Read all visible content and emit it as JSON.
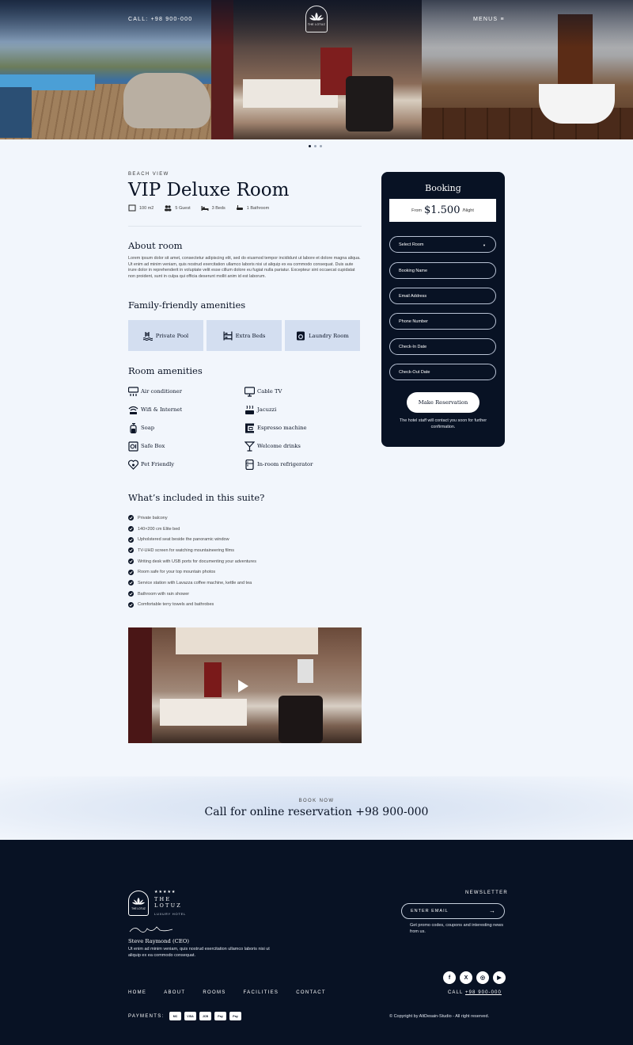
{
  "header": {
    "call_label": "CALL: +98 900-000",
    "menu_label": "MENUS",
    "logo_text": "THE LOTUZ"
  },
  "room": {
    "eyebrow": "BEACH VIEW",
    "title": "VIP Deluxe Room",
    "specs": {
      "size": "100 m2",
      "guests": "5 Guest",
      "beds": "3 Beds",
      "bathrooms": "1 Bathroom"
    }
  },
  "about": {
    "heading": "About room",
    "text": "Lorem ipsum dolor sit amet, consectetur adipiscing elit, sed do eiusmod tempor incididunt ut labore et dolore magna aliqua. Ut enim ad minim veniam, quis nostrud exercitation ullamco laboris nisi ut aliquip ex ea commodo consequat. Duis aute irure dolor in reprehenderit in voluptate velit esse cillum dolore eu fugiat nulla pariatur. Excepteur sint occaecat cupidatat non proident, sunt in culpa qui officia deserunt mollit anim id est laborum."
  },
  "family": {
    "heading": "Family-friendly amenities",
    "items": [
      {
        "label": "Private Pool",
        "icon": "pool-icon"
      },
      {
        "label": "Extra Beds",
        "icon": "bunk-bed-icon"
      },
      {
        "label": "Laundry Room",
        "icon": "washing-machine-icon"
      }
    ]
  },
  "amenities": {
    "heading": "Room amenities",
    "items": [
      {
        "label": "Air conditioner",
        "icon": "air-conditioner-icon"
      },
      {
        "label": "Cable TV",
        "icon": "tv-icon"
      },
      {
        "label": "Wifi & Internet",
        "icon": "wifi-icon"
      },
      {
        "label": "Jacuzzi",
        "icon": "jacuzzi-icon"
      },
      {
        "label": "Soap",
        "icon": "soap-icon"
      },
      {
        "label": "Espresso machine",
        "icon": "espresso-icon"
      },
      {
        "label": "Safe Box",
        "icon": "safe-icon"
      },
      {
        "label": "Welcome drinks",
        "icon": "cocktail-icon"
      },
      {
        "label": "Pet Friendly",
        "icon": "pet-heart-icon"
      },
      {
        "label": "In-room refrigerator",
        "icon": "fridge-icon"
      }
    ]
  },
  "included": {
    "heading": "What’s included in this suite?",
    "items": [
      "Private balcony",
      "140×200 cm Elite bed",
      "Upholstered seat beside the panoramic window",
      "TV-UHD screen for watching mountaineering films",
      "Writing desk with USB ports for documenting your adventures",
      "Room safe for your top mountain photos",
      "Service station with Lavazza coffee machine, kettle and tea",
      "Bathroom with rain shower",
      "Comfortable terry towels and bathrobes"
    ]
  },
  "booking": {
    "title": "Booking",
    "price_from": "From",
    "price_amount": "$1.500",
    "price_unit": "/Night",
    "fields": {
      "room": "Select Room",
      "name": "Booking Name",
      "email": "Email Address",
      "phone": "Phone Number",
      "checkin": "Check-In Date",
      "checkout": "Check-Out Date"
    },
    "button": "Make Reservation",
    "note": "The hotel staff will contact you soon for further confirmation."
  },
  "cta": {
    "eyebrow": "BOOK NOW",
    "title": "Call for online reservation +98 900-000"
  },
  "footer": {
    "stars": "★★★★★",
    "brand": "THE LOTUZ",
    "brand_sub": "LUXURY HOTEL",
    "logo_text": "THE LOTUZ",
    "ceo_name": "Steve Raymond (CEO)",
    "quote": "Ut enim ad minim veniam, quis nostrud exercitation ullamco laboris nisi ut aliquip ex ea commodo consequat.",
    "newsletter_label": "NEWSLETTER",
    "email_placeholder": "ENTER EMAIL",
    "newsletter_note": "Get promo codes, coupons and interesting news from us.",
    "nav": [
      "HOME",
      "ABOUT",
      "ROOMS",
      "FACILITIES",
      "CONTACT"
    ],
    "call_prefix": "CALL",
    "call_number": "+98 900-000",
    "payments_label": "PAYMENTS:",
    "payments": [
      "MC",
      "VISA",
      "JCB",
      "Pay",
      "Pay"
    ],
    "copyright": "© Copyright by AltDesain-Studio - All right reserved.",
    "socials": [
      "f",
      "X",
      "◎",
      "▶"
    ]
  }
}
